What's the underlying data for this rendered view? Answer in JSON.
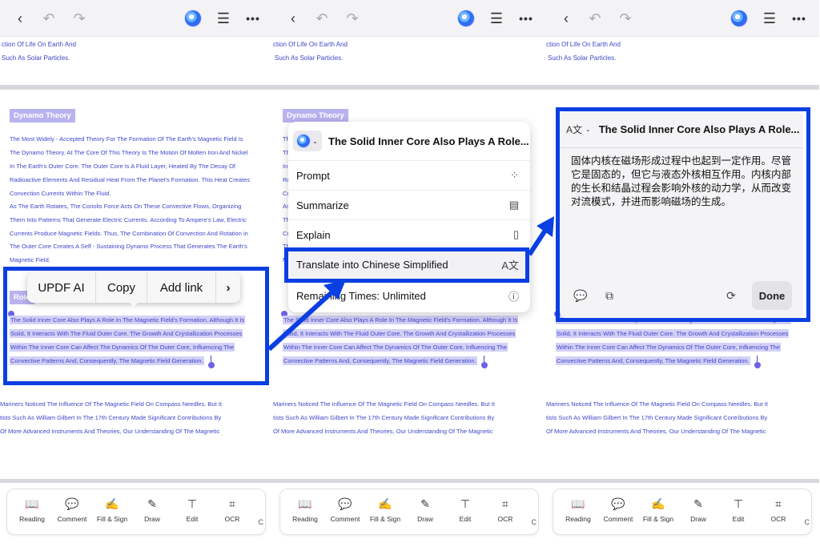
{
  "colors": {
    "accent_text": "#3f47c9",
    "selection": "#d3d0f7",
    "heading_bg": "#b8b3ee",
    "annotation_blue": "#0a3fe2"
  },
  "icons": {
    "back": "chevron-left-icon",
    "undo": "undo-icon",
    "redo": "redo-icon",
    "ai": "updf-ai-icon",
    "outline": "outline-icon",
    "more": "more-icon"
  },
  "document": {
    "top_lines": [
      "ction Of Life On Earth And",
      "Such As Solar Particles."
    ],
    "heading": "Dynamo Theory",
    "body_lines": [
      "The Most Widely - Accepted Theory For The Formation Of The Earth's Magnetic Field Is",
      "The Dynamo Theory. At The Core Of This Theory Is The Motion Of Molten Iron And Nickel",
      "In The Earth's Outer Core. The Outer Core Is A Fluid Layer, Heated By The Decay Of",
      "Radioactive Elements And Residual Heat From The Planet's Formation. This Heat Creates",
      "Convection Currents Within The Fluid.",
      "As The Earth Rotates, The Coriolis Force Acts On These Convective Flows, Organizing",
      "Them Into Patterns That Generate Electric Currents. According To Ampere's Law, Electric",
      "Currents Produce Magnetic Fields. Thus, The Combination Of Convection And Rotation in",
      "The Outer Core Creates A Self - Sustaining Dynamo Process That Generates The Earth's",
      "Magnetic Field."
    ],
    "role_tag": "Role",
    "selected_lines": [
      "The Solid Inner Core Also Plays A Role In The Magnetic Field's Formation. Although It Is",
      "Solid, It Interacts With The Fluid Outer Core. The Growth And Crystallization Processes",
      "Within The Inner Core Can Affect The Dynamics Of The Outer Core, Influencing The",
      "Convective Patterns And, Consequently, The Magnetic Field Generation."
    ],
    "lower_lines": [
      "Mariners Noticed The Influence Of The Magnetic Field On Compass Needles. But It",
      "tists Such As William Gilbert In The 17th Century Made Significant Contributions By",
      "Of More Advanced Instruments And Theories, Our Understanding Of The Magnetic"
    ]
  },
  "bottom_toolbar": {
    "items": [
      {
        "label": "Reading",
        "icon": "book-icon"
      },
      {
        "label": "Comment",
        "icon": "comment-icon"
      },
      {
        "label": "Fill & Sign",
        "icon": "signature-icon"
      },
      {
        "label": "Draw",
        "icon": "pen-icon"
      },
      {
        "label": "Edit",
        "icon": "text-edit-icon"
      },
      {
        "label": "OCR",
        "icon": "ocr-icon"
      }
    ],
    "overflow": "C"
  },
  "context_menu": {
    "items": [
      "UPDF AI",
      "Copy",
      "Add link",
      "›"
    ]
  },
  "ai_menu": {
    "title": "The Solid Inner Core Also Plays A Role...",
    "items": [
      {
        "label": "Prompt",
        "icon": "prompt-icon"
      },
      {
        "label": "Summarize",
        "icon": "summarize-icon"
      },
      {
        "label": "Explain",
        "icon": "book-icon"
      },
      {
        "label": "Translate into Chinese Simplified",
        "icon": "translate-icon"
      },
      {
        "label": "Remaining Times: Unlimited",
        "icon": "info-icon"
      }
    ]
  },
  "translation": {
    "title": "The Solid Inner Core Also Plays A Role...",
    "text": "固体内核在磁场形成过程中也起到一定作用。尽管它是固态的，但它与液态外核相互作用。内核内部的生长和结晶过程会影响外核的动力学，从而改变对流模式，并进而影响磁场的生成。",
    "done_label": "Done"
  }
}
